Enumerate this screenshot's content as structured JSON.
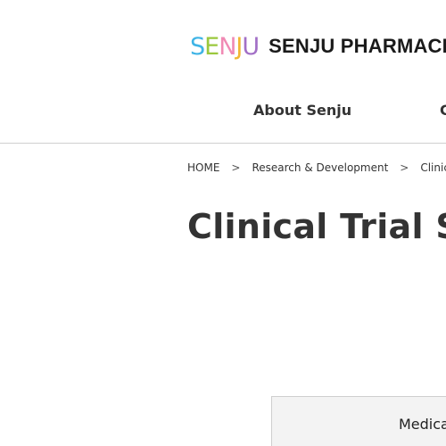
{
  "header": {
    "logo_mark": "SENJU",
    "logo_text": "SENJU PHARMACE",
    "nav": [
      {
        "label": "About Senju"
      },
      {
        "label": "C"
      }
    ]
  },
  "breadcrumb": [
    {
      "label": "HOME"
    },
    {
      "label": "Research & Development"
    },
    {
      "label": "Clinical Tr"
    }
  ],
  "breadcrumb_separator": ">",
  "page_title": "Clinical Trial Sum",
  "panel": {
    "label": "Medica"
  },
  "colors": {
    "logo_letters": [
      "#3fb4e6",
      "#9bc83d",
      "#f08ab4",
      "#f2b632",
      "#a26fc6"
    ],
    "divider": "#d0d0d0",
    "panel_bg": "#f3f3f3"
  }
}
